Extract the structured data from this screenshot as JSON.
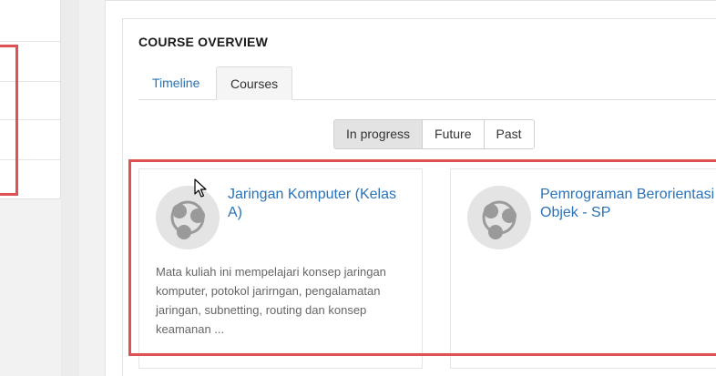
{
  "block": {
    "title": "COURSE OVERVIEW"
  },
  "tabs": [
    {
      "label": "Timeline"
    },
    {
      "label": "Courses"
    }
  ],
  "filters": [
    {
      "label": "In progress",
      "active": true
    },
    {
      "label": "Future",
      "active": false
    },
    {
      "label": "Past",
      "active": false
    }
  ],
  "courses": [
    {
      "title": "Jaringan Komputer (Kelas A)",
      "description": "Mata kuliah ini mempelajari konsep jaringan komputer, potokol jarirngan, pengalamatan jaringan, subnetting, routing dan konsep keamanan ..."
    },
    {
      "title": "Pemrograman Berorientasi Objek - SP",
      "description": ""
    }
  ],
  "colors": {
    "link": "#2a73b8",
    "highlight": "#e05252",
    "active_filter": "#e3e3e3"
  },
  "icons": {
    "course": "course-pie-icon",
    "cursor": "mouse-pointer-icon"
  }
}
